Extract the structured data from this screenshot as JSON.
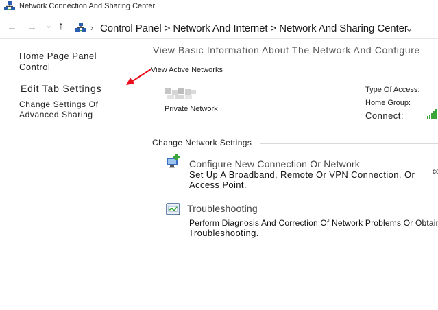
{
  "window": {
    "title": "Network Connection And Sharing Center"
  },
  "nav": {
    "back_glyph": "←",
    "forward_glyph": "→",
    "recent_glyph": "⌄",
    "up_glyph": "↑",
    "address_separator": "›",
    "address": "Control Panel > Network And Internet > Network And Sharing Center",
    "address_caret": "⌄"
  },
  "sidebar": {
    "home_line1": "Home Page Panel",
    "home_line2": "Control",
    "edit_tab": "Edit Tab Settings",
    "advanced_line1": "Change Settings Of",
    "advanced_line2": "Advanced Sharing"
  },
  "main": {
    "heading": "View Basic Information About The Network And Configure",
    "active_label": "View Active Networks",
    "network_type": "Private Network",
    "access_type_label": "Type Of Access:",
    "home_group_label": "Home Group:",
    "connect_label": "Connect:",
    "change_label": "Change Network Settings",
    "task1_title": "Configure New Connection Or Network",
    "task1_desc_line1": "Set Up A Broadband, Remote Or VPN Connection, Or",
    "task1_desc_overflow": "co",
    "task1_desc_line2": "Access Point.",
    "task2_title": "Troubleshooting",
    "task2_desc_line1": "Perform Diagnosis And Correction Of Network Problems Or Obtain",
    "task2_desc_line2": "Troubleshooting."
  },
  "icons": {
    "title": "network-center-icon",
    "address": "control-panel-icon",
    "network": "network-blurred-icon",
    "signal": "signal-bars-icon",
    "task1": "new-connection-icon",
    "task2": "troubleshoot-icon",
    "annotation": "red-arrow-icon"
  },
  "colors": {
    "annotation_arrow": "#e8101c",
    "signal_bars": "#3aa63a",
    "icon_blue": "#2a5db0",
    "icon_green": "#4caf50"
  }
}
